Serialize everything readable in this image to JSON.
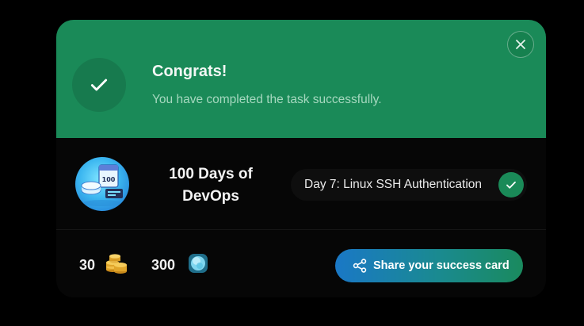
{
  "banner": {
    "title": "Congrats!",
    "subtitle": "You have completed the task successfully."
  },
  "course": {
    "name_line1": "100 Days of",
    "name_line2": "DevOps",
    "logo_badge": "100"
  },
  "task": {
    "label": "Day 7: Linux SSH Authentication"
  },
  "rewards": {
    "coins": "30",
    "gems": "300"
  },
  "share": {
    "label": "Share your success card"
  },
  "colors": {
    "banner_green": "#1a8a58",
    "gradient_start": "#1a78c6",
    "gradient_end": "#1a8a5e"
  },
  "icons": {
    "banner_check": "check-icon",
    "close": "close-icon",
    "task_check": "check-icon",
    "coins": "coins-icon",
    "gem": "gem-icon",
    "share": "share-icon"
  }
}
